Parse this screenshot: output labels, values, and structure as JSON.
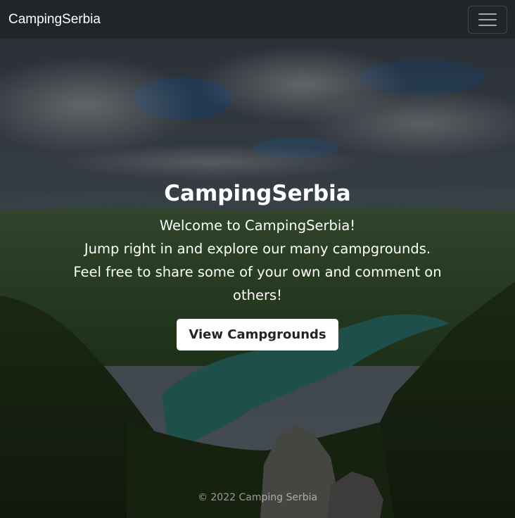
{
  "navbar": {
    "brand": "CampingSerbia",
    "toggler_icon": "hamburger-menu-icon"
  },
  "hero": {
    "title": "CampingSerbia",
    "lead_line_1": "Welcome to CampingSerbia!",
    "lead_line_2": "Jump right in and explore our many campgrounds.",
    "lead_line_3": "Feel free to share some of your own and comment on others!",
    "button_label": "View Campgrounds"
  },
  "footer": {
    "copyright": "© 2022 Camping Serbia"
  },
  "colors": {
    "navbar_bg": "#212529",
    "button_bg": "#ffffff",
    "button_text": "#212529"
  }
}
